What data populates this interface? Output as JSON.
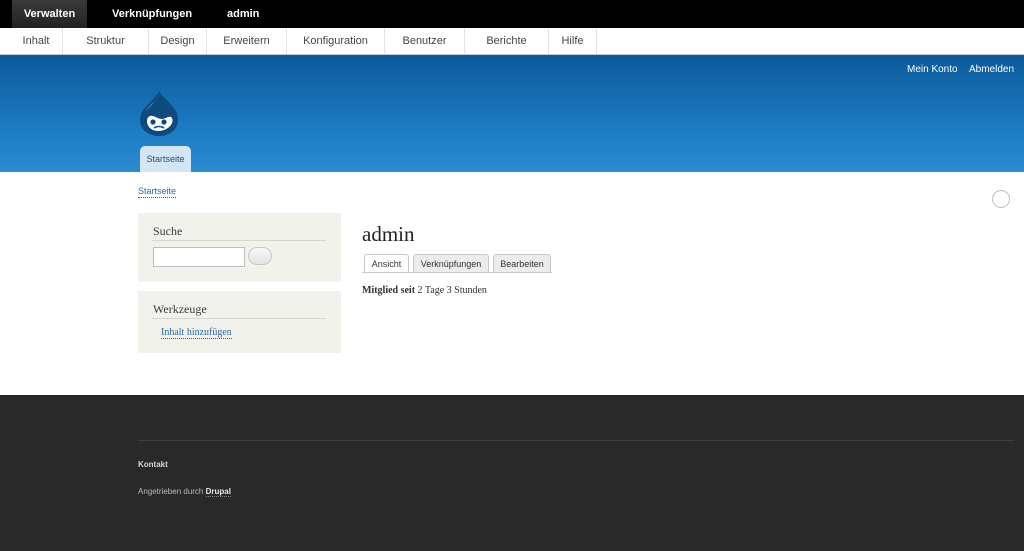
{
  "toolbar": {
    "items": [
      {
        "label": "Verwalten"
      },
      {
        "label": "Verknüpfungen"
      },
      {
        "label": "admin"
      }
    ]
  },
  "admin_menu": {
    "items": [
      {
        "label": "Inhalt"
      },
      {
        "label": "Struktur"
      },
      {
        "label": "Design"
      },
      {
        "label": "Erweitern"
      },
      {
        "label": "Konfiguration"
      },
      {
        "label": "Benutzer"
      },
      {
        "label": "Berichte"
      },
      {
        "label": "Hilfe"
      }
    ]
  },
  "header": {
    "my_account": "Mein Konto",
    "logout": "Abmelden",
    "logo_icon": "drupal-drop-logo",
    "home_tab": "Startseite"
  },
  "breadcrumb": {
    "home": "Startseite"
  },
  "sidebar": {
    "search": {
      "title": "Suche",
      "input_value": ""
    },
    "tools": {
      "title": "Werkzeuge",
      "link": "Inhalt hinzufügen"
    }
  },
  "main": {
    "title": "admin",
    "tabs": [
      {
        "label": "Ansicht",
        "active": true
      },
      {
        "label": "Verknüpfungen",
        "active": false
      },
      {
        "label": "Bearbeiten",
        "active": false
      }
    ],
    "member_label": "Mitglied seit",
    "member_value": "2 Tage 3 Stunden"
  },
  "footer": {
    "contact": "Kontakt",
    "powered_by": "Angetrieben durch",
    "drupal": "Drupal"
  },
  "colors": {
    "header_blue": "#1e7fc6",
    "link_blue": "#2c6aa3",
    "footer_dark": "#292929"
  }
}
